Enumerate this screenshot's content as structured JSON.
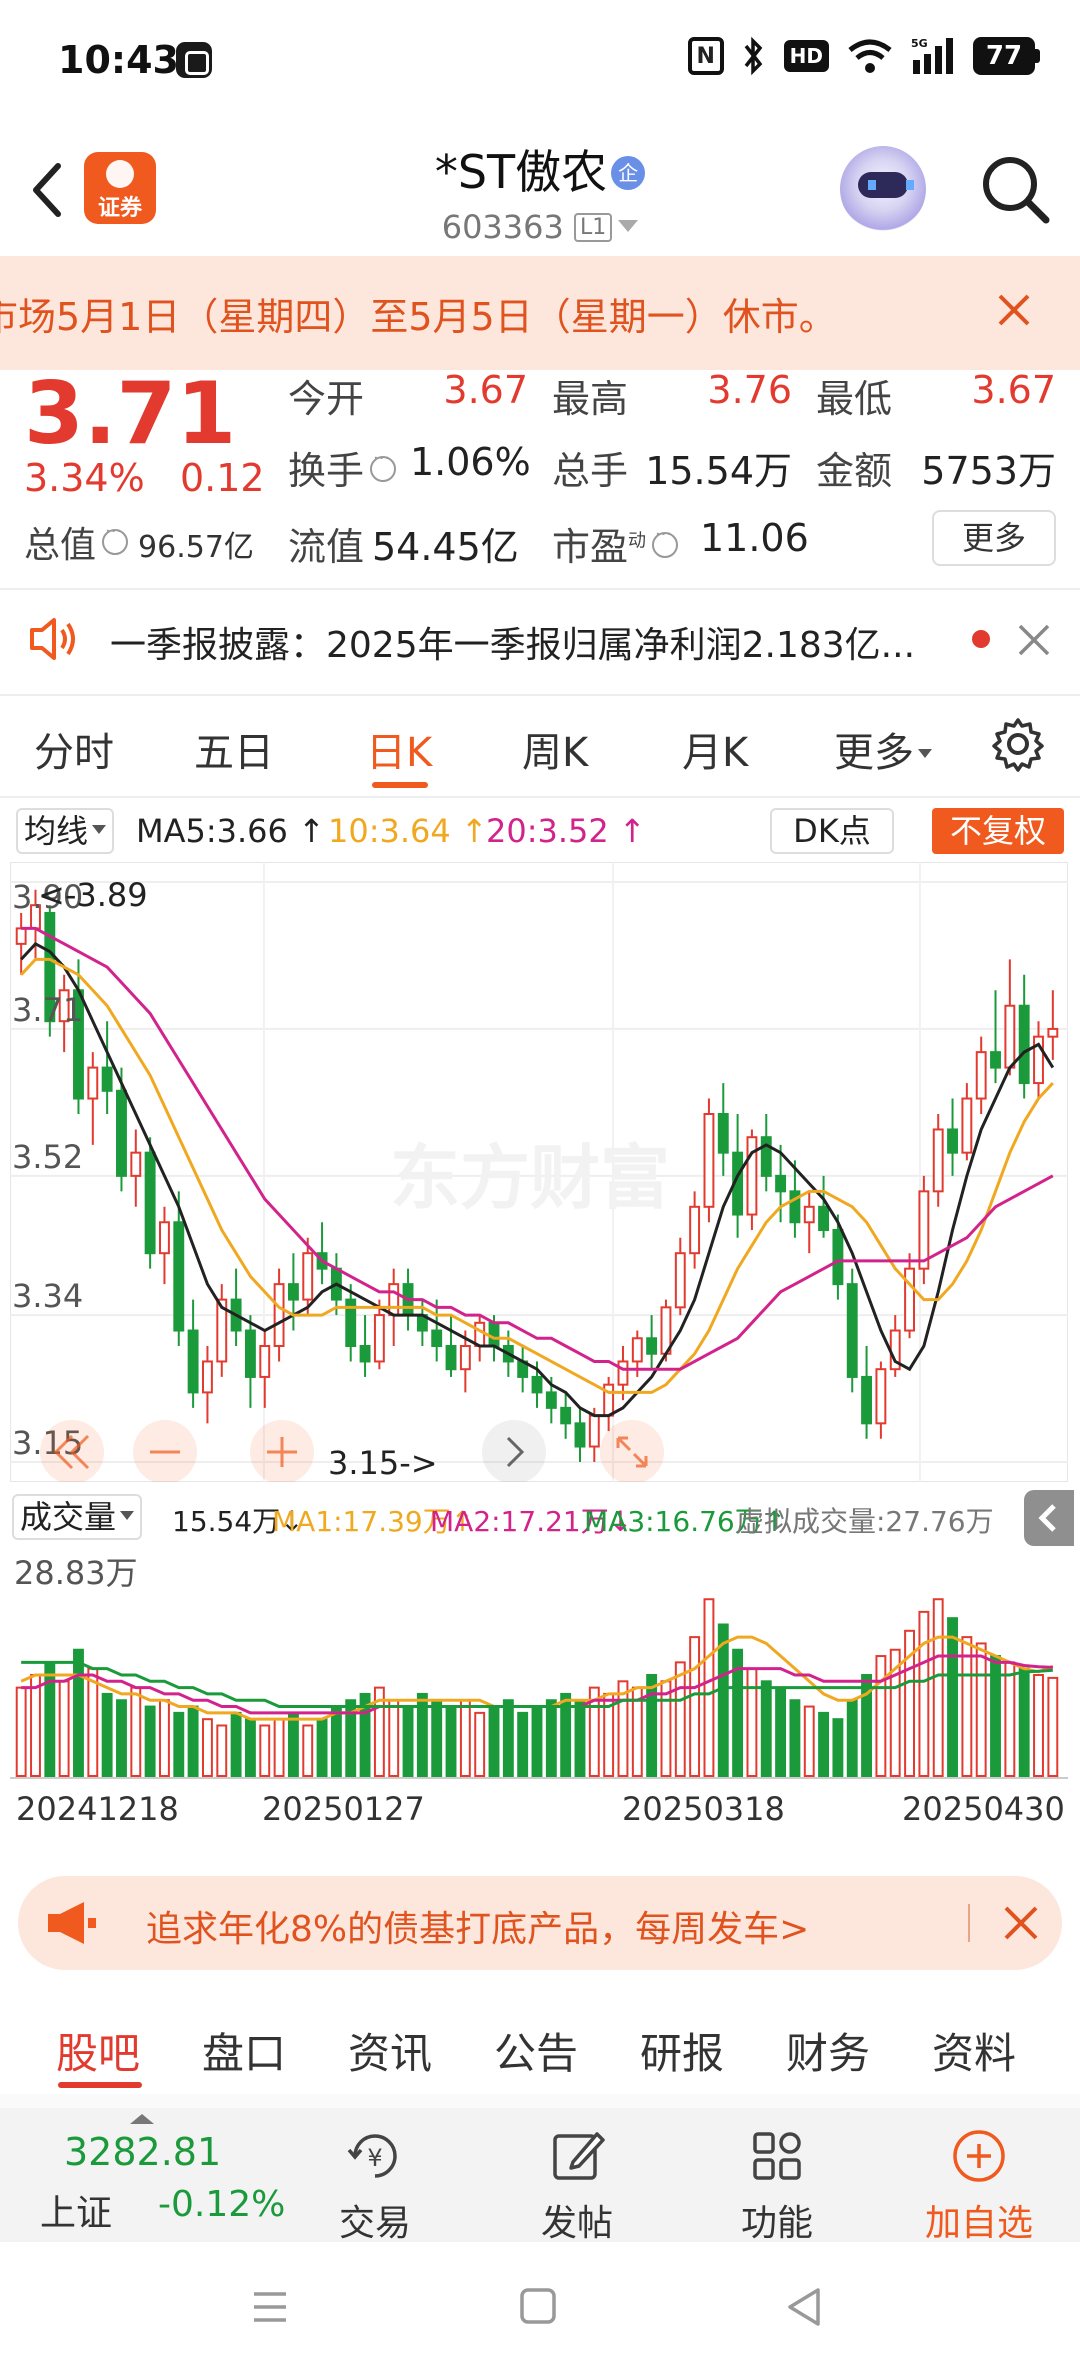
{
  "status_bar": {
    "time": "10:43",
    "hd": "HD",
    "battery": "77",
    "nfc": "N"
  },
  "header": {
    "logo_label": "证券",
    "stock_name": "*ST傲农",
    "badge": "企",
    "code": "603363",
    "board_tag": "L1"
  },
  "notice": {
    "text": "市场5月1日（星期四）至5月5日（星期一）休市。"
  },
  "quote": {
    "price": "3.71",
    "change_pct": "3.34%",
    "change": "0.12",
    "total_value_label": "总值",
    "total_value": "96.57亿",
    "open_label": "今开",
    "open": "3.67",
    "high_label": "最高",
    "high": "3.76",
    "low_label": "最低",
    "low": "3.67",
    "turnover_label": "换手",
    "turnover": "1.06%",
    "volume_label": "总手",
    "volume": "15.54万",
    "amount_label": "金额",
    "amount": "5753万",
    "float_value_label": "流值",
    "float_value": "54.45亿",
    "pe_label": "市盈",
    "pe_sup": "动",
    "pe": "11.06",
    "more_label": "更多"
  },
  "announcement": {
    "text": "一季报披露：2025年一季报归属净利润2.183亿..."
  },
  "period_tabs": [
    "分时",
    "五日",
    "日K",
    "周K",
    "月K",
    "更多"
  ],
  "active_period": "日K",
  "ma_row": {
    "selector": "均线",
    "ma5": "MA5:3.66 ↑",
    "ma10": "10:3.64 ↑",
    "ma20": "20:3.52 ↑",
    "dk_label": "DK点",
    "adjust_label": "不复权"
  },
  "colors": {
    "up": "#e23a2f",
    "down": "#1a9a3a",
    "accent": "#f05a1e",
    "ma5": "#222222",
    "ma10": "#f0a820",
    "ma20": "#d2238c"
  },
  "kchart": {
    "y_ticks": [
      "3.90",
      "3.71",
      "3.52",
      "3.34",
      "3.15"
    ],
    "high_marker": "<-3.89",
    "low_marker": "3.15->",
    "watermark": "东方财富"
  },
  "volume": {
    "selector": "成交量",
    "vol": "15.54万↓",
    "ma1": "MA1:17.39万↑",
    "ma2": "MA2:17.21万↓",
    "ma3": "MA3:16.76万↑",
    "virtual": "虚拟成交量:27.76万",
    "max_label": "28.83万"
  },
  "dates": [
    "20241218",
    "20250127",
    "20250318",
    "20250430"
  ],
  "chart_data": {
    "type": "candlestick",
    "x_range": [
      "20241218",
      "20250430"
    ],
    "ylim": [
      3.15,
      3.9
    ],
    "y_ticks": [
      3.9,
      3.71,
      3.52,
      3.34,
      3.15
    ],
    "annotations": [
      {
        "label": "<-3.89"
      },
      {
        "label": "3.15->"
      }
    ],
    "candles": [
      [
        3.82,
        3.86,
        3.78,
        3.84
      ],
      [
        3.84,
        3.89,
        3.8,
        3.87
      ],
      [
        3.86,
        3.87,
        3.7,
        3.72
      ],
      [
        3.72,
        3.78,
        3.68,
        3.76
      ],
      [
        3.76,
        3.8,
        3.6,
        3.62
      ],
      [
        3.62,
        3.68,
        3.56,
        3.66
      ],
      [
        3.66,
        3.72,
        3.6,
        3.63
      ],
      [
        3.63,
        3.66,
        3.5,
        3.52
      ],
      [
        3.52,
        3.58,
        3.48,
        3.55
      ],
      [
        3.55,
        3.57,
        3.4,
        3.42
      ],
      [
        3.42,
        3.48,
        3.38,
        3.46
      ],
      [
        3.46,
        3.5,
        3.3,
        3.32
      ],
      [
        3.32,
        3.36,
        3.22,
        3.24
      ],
      [
        3.24,
        3.3,
        3.2,
        3.28
      ],
      [
        3.28,
        3.38,
        3.26,
        3.36
      ],
      [
        3.36,
        3.4,
        3.3,
        3.32
      ],
      [
        3.32,
        3.34,
        3.22,
        3.26
      ],
      [
        3.26,
        3.32,
        3.22,
        3.3
      ],
      [
        3.3,
        3.4,
        3.28,
        3.38
      ],
      [
        3.38,
        3.42,
        3.32,
        3.36
      ],
      [
        3.36,
        3.44,
        3.34,
        3.42
      ],
      [
        3.42,
        3.46,
        3.38,
        3.4
      ],
      [
        3.4,
        3.42,
        3.34,
        3.36
      ],
      [
        3.36,
        3.38,
        3.28,
        3.3
      ],
      [
        3.3,
        3.34,
        3.26,
        3.28
      ],
      [
        3.28,
        3.36,
        3.27,
        3.34
      ],
      [
        3.34,
        3.4,
        3.3,
        3.38
      ],
      [
        3.38,
        3.4,
        3.32,
        3.34
      ],
      [
        3.34,
        3.36,
        3.3,
        3.32
      ],
      [
        3.32,
        3.36,
        3.28,
        3.3
      ],
      [
        3.3,
        3.34,
        3.26,
        3.27
      ],
      [
        3.27,
        3.32,
        3.24,
        3.3
      ],
      [
        3.3,
        3.34,
        3.28,
        3.33
      ],
      [
        3.33,
        3.34,
        3.28,
        3.3
      ],
      [
        3.3,
        3.32,
        3.26,
        3.28
      ],
      [
        3.28,
        3.3,
        3.24,
        3.26
      ],
      [
        3.26,
        3.28,
        3.22,
        3.24
      ],
      [
        3.24,
        3.26,
        3.2,
        3.22
      ],
      [
        3.22,
        3.24,
        3.18,
        3.2
      ],
      [
        3.2,
        3.22,
        3.15,
        3.17
      ],
      [
        3.17,
        3.22,
        3.15,
        3.21
      ],
      [
        3.21,
        3.26,
        3.19,
        3.25
      ],
      [
        3.25,
        3.3,
        3.23,
        3.28
      ],
      [
        3.28,
        3.32,
        3.26,
        3.31
      ],
      [
        3.31,
        3.34,
        3.27,
        3.29
      ],
      [
        3.29,
        3.36,
        3.28,
        3.35
      ],
      [
        3.35,
        3.44,
        3.34,
        3.42
      ],
      [
        3.42,
        3.5,
        3.4,
        3.48
      ],
      [
        3.48,
        3.62,
        3.46,
        3.6
      ],
      [
        3.6,
        3.64,
        3.52,
        3.55
      ],
      [
        3.55,
        3.6,
        3.44,
        3.47
      ],
      [
        3.47,
        3.58,
        3.45,
        3.57
      ],
      [
        3.57,
        3.6,
        3.5,
        3.52
      ],
      [
        3.52,
        3.56,
        3.46,
        3.5
      ],
      [
        3.5,
        3.54,
        3.44,
        3.46
      ],
      [
        3.46,
        3.5,
        3.42,
        3.48
      ],
      [
        3.48,
        3.52,
        3.44,
        3.45
      ],
      [
        3.45,
        3.47,
        3.36,
        3.38
      ],
      [
        3.38,
        3.4,
        3.24,
        3.26
      ],
      [
        3.26,
        3.3,
        3.18,
        3.2
      ],
      [
        3.2,
        3.28,
        3.18,
        3.27
      ],
      [
        3.27,
        3.34,
        3.26,
        3.32
      ],
      [
        3.32,
        3.42,
        3.31,
        3.4
      ],
      [
        3.4,
        3.52,
        3.38,
        3.5
      ],
      [
        3.5,
        3.6,
        3.48,
        3.58
      ],
      [
        3.58,
        3.62,
        3.52,
        3.55
      ],
      [
        3.55,
        3.64,
        3.54,
        3.62
      ],
      [
        3.62,
        3.7,
        3.6,
        3.68
      ],
      [
        3.68,
        3.76,
        3.64,
        3.66
      ],
      [
        3.66,
        3.8,
        3.65,
        3.74
      ],
      [
        3.74,
        3.78,
        3.62,
        3.64
      ],
      [
        3.64,
        3.72,
        3.62,
        3.7
      ],
      [
        3.7,
        3.76,
        3.67,
        3.71
      ]
    ],
    "candle_fields": [
      "open",
      "high",
      "low",
      "close"
    ],
    "series": [
      {
        "name": "MA5",
        "values": [
          3.8,
          3.82,
          3.81,
          3.79,
          3.76,
          3.72,
          3.68,
          3.64,
          3.6,
          3.56,
          3.52,
          3.48,
          3.43,
          3.38,
          3.35,
          3.34,
          3.33,
          3.32,
          3.33,
          3.34,
          3.35,
          3.37,
          3.38,
          3.37,
          3.36,
          3.35,
          3.34,
          3.34,
          3.34,
          3.33,
          3.32,
          3.31,
          3.3,
          3.3,
          3.29,
          3.28,
          3.27,
          3.25,
          3.24,
          3.22,
          3.21,
          3.21,
          3.22,
          3.24,
          3.26,
          3.29,
          3.32,
          3.36,
          3.42,
          3.48,
          3.52,
          3.55,
          3.56,
          3.55,
          3.53,
          3.51,
          3.49,
          3.46,
          3.42,
          3.37,
          3.32,
          3.28,
          3.27,
          3.3,
          3.37,
          3.45,
          3.52,
          3.58,
          3.62,
          3.66,
          3.68,
          3.69,
          3.66
        ]
      },
      {
        "name": "MA10",
        "values": [
          3.78,
          3.8,
          3.8,
          3.79,
          3.78,
          3.76,
          3.74,
          3.71,
          3.68,
          3.65,
          3.61,
          3.57,
          3.53,
          3.49,
          3.45,
          3.42,
          3.39,
          3.37,
          3.35,
          3.34,
          3.34,
          3.34,
          3.35,
          3.35,
          3.35,
          3.35,
          3.35,
          3.35,
          3.35,
          3.34,
          3.34,
          3.33,
          3.32,
          3.31,
          3.31,
          3.3,
          3.29,
          3.28,
          3.27,
          3.26,
          3.25,
          3.24,
          3.24,
          3.24,
          3.24,
          3.25,
          3.27,
          3.29,
          3.32,
          3.36,
          3.4,
          3.43,
          3.46,
          3.48,
          3.49,
          3.5,
          3.5,
          3.49,
          3.48,
          3.46,
          3.43,
          3.4,
          3.38,
          3.36,
          3.36,
          3.38,
          3.41,
          3.45,
          3.5,
          3.55,
          3.59,
          3.62,
          3.64
        ]
      },
      {
        "name": "MA20",
        "values": [
          3.84,
          3.84,
          3.83,
          3.82,
          3.81,
          3.8,
          3.79,
          3.77,
          3.75,
          3.73,
          3.7,
          3.67,
          3.64,
          3.61,
          3.58,
          3.55,
          3.52,
          3.49,
          3.47,
          3.45,
          3.43,
          3.41,
          3.4,
          3.39,
          3.38,
          3.37,
          3.37,
          3.36,
          3.36,
          3.35,
          3.35,
          3.34,
          3.34,
          3.33,
          3.33,
          3.32,
          3.31,
          3.31,
          3.3,
          3.29,
          3.28,
          3.28,
          3.27,
          3.27,
          3.27,
          3.27,
          3.27,
          3.28,
          3.29,
          3.3,
          3.31,
          3.33,
          3.35,
          3.37,
          3.38,
          3.39,
          3.4,
          3.41,
          3.41,
          3.41,
          3.41,
          3.41,
          3.41,
          3.41,
          3.42,
          3.43,
          3.44,
          3.46,
          3.48,
          3.49,
          3.5,
          3.51,
          3.52
        ]
      }
    ],
    "volume": {
      "ylim": [
        0,
        28.83
      ],
      "unit": "万",
      "values": [
        14,
        16,
        18,
        15,
        20,
        17,
        13,
        12,
        14,
        11,
        12,
        10,
        11,
        9,
        8,
        10,
        9,
        8,
        9,
        10,
        8,
        9,
        11,
        12,
        13,
        14,
        12,
        11,
        13,
        12,
        11,
        12,
        10,
        11,
        12,
        10,
        11,
        12,
        13,
        12,
        14,
        13,
        15,
        14,
        16,
        15,
        18,
        22,
        28,
        24,
        20,
        17,
        15,
        14,
        12,
        11,
        10,
        9,
        12,
        16,
        19,
        20,
        23,
        26,
        28,
        25,
        22,
        21,
        19,
        18,
        17,
        16,
        15.54
      ],
      "up": [
        1,
        1,
        0,
        1,
        0,
        1,
        0,
        0,
        1,
        0,
        1,
        0,
        0,
        1,
        1,
        0,
        0,
        1,
        1,
        0,
        1,
        0,
        0,
        0,
        0,
        1,
        1,
        0,
        0,
        0,
        0,
        1,
        1,
        0,
        0,
        0,
        0,
        0,
        0,
        0,
        1,
        1,
        1,
        1,
        0,
        1,
        1,
        1,
        1,
        0,
        0,
        1,
        0,
        0,
        0,
        1,
        0,
        0,
        0,
        0,
        1,
        1,
        1,
        1,
        1,
        0,
        1,
        1,
        0,
        1,
        0,
        1,
        1
      ],
      "series": [
        {
          "name": "MA1",
          "values": [
            15,
            16,
            16,
            16,
            16,
            15,
            14,
            13,
            13,
            12,
            12,
            11,
            11,
            10,
            10,
            10,
            9,
            9,
            9,
            9,
            9,
            9,
            10,
            10,
            11,
            12,
            12,
            12,
            12,
            12,
            12,
            12,
            12,
            11,
            11,
            11,
            11,
            11,
            12,
            12,
            12,
            13,
            13,
            14,
            14,
            15,
            16,
            17,
            19,
            21,
            22,
            22,
            21,
            19,
            17,
            15,
            13,
            12,
            12,
            13,
            15,
            17,
            19,
            21,
            22,
            22,
            21,
            20,
            19,
            18,
            17,
            16.5,
            17.39
          ]
        },
        {
          "name": "MA2",
          "values": [
            14,
            14,
            15,
            15,
            16,
            16,
            15,
            15,
            14,
            14,
            13,
            13,
            12,
            12,
            11,
            11,
            10,
            10,
            10,
            10,
            10,
            10,
            10,
            10,
            10,
            11,
            11,
            11,
            11,
            11,
            11,
            11,
            11,
            11,
            11,
            11,
            11,
            11,
            11,
            11,
            12,
            12,
            12,
            12,
            13,
            13,
            14,
            14,
            15,
            16,
            17,
            17,
            17,
            17,
            16,
            16,
            15,
            15,
            15,
            15,
            15,
            16,
            17,
            18,
            19,
            19,
            19,
            19,
            18,
            18,
            17.5,
            17.3,
            17.21
          ]
        },
        {
          "name": "MA3",
          "values": [
            18,
            18,
            18,
            18,
            18,
            17,
            17,
            16,
            16,
            15,
            15,
            14,
            14,
            13,
            13,
            12,
            12,
            12,
            11,
            11,
            11,
            11,
            11,
            11,
            11,
            11,
            11,
            11,
            11,
            11,
            11,
            11,
            11,
            11,
            11,
            11,
            11,
            11,
            11,
            11,
            11,
            11,
            12,
            12,
            12,
            12,
            12,
            13,
            13,
            14,
            14,
            14,
            14,
            14,
            14,
            14,
            14,
            14,
            14,
            14,
            14,
            14,
            15,
            15,
            16,
            16,
            16,
            16,
            16,
            16,
            16.5,
            16.6,
            16.76
          ]
        }
      ]
    }
  },
  "promo": {
    "text": "追求年化8%的债基打底产品，每周发车>"
  },
  "bottom_tabs": [
    "股吧",
    "盘口",
    "资讯",
    "公告",
    "研报",
    "财务",
    "资料"
  ],
  "active_bottom_tab": "股吧",
  "bottom_bar": {
    "index_value": "3282.81",
    "index_name": "上证",
    "index_change": "-0.12%",
    "trade": "交易",
    "post": "发帖",
    "functions": "功能",
    "add_watch": "加自选"
  }
}
